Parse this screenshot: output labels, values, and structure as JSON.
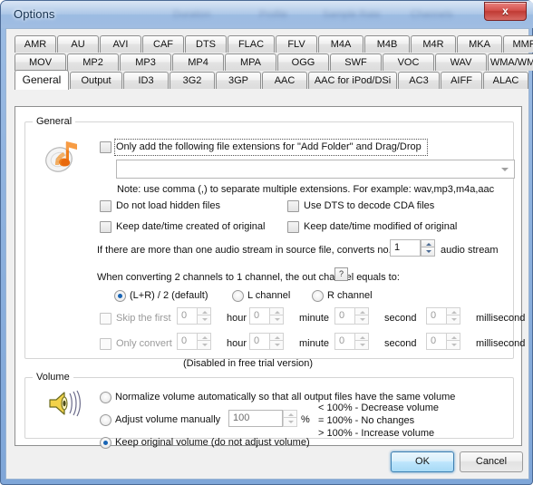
{
  "window": {
    "title": "Options",
    "close_label": "x"
  },
  "tabs": {
    "row1": [
      "AMR",
      "AU",
      "AVI",
      "CAF",
      "DTS",
      "FLAC",
      "FLV",
      "M4A",
      "M4B",
      "M4R",
      "MKA",
      "MMF"
    ],
    "row2": [
      "MOV",
      "MP2",
      "MP3",
      "MP4",
      "MPA",
      "OGG",
      "SWF",
      "VOC",
      "WAV",
      "WMA/WMV/ASF"
    ],
    "row3": [
      "General",
      "Output",
      "ID3",
      "3G2",
      "3GP",
      "AAC",
      "AAC for iPod/DSi",
      "AC3",
      "AIFF",
      "ALAC"
    ],
    "selected": "General"
  },
  "general": {
    "group_title": "General",
    "icon": "cd-music-note-icon",
    "only_add_label": "Only add the following file extensions for \"Add Folder\" and Drag/Drop",
    "only_add_checked": false,
    "extensions_value": "",
    "extensions_placeholder": "",
    "note": "Note: use comma (,) to separate multiple extensions. For example: wav,mp3,m4a,aac",
    "do_not_load_hidden_label": "Do not load hidden files",
    "do_not_load_hidden_checked": false,
    "use_dts_label": "Use DTS to decode CDA files",
    "use_dts_checked": false,
    "keep_created_label": "Keep date/time created of original",
    "keep_created_checked": false,
    "keep_modified_label": "Keep date/time modified of original",
    "keep_modified_checked": false,
    "stream_prefix": "If there are more than one audio stream in source file, converts no.",
    "stream_value": "1",
    "stream_suffix": "audio stream",
    "channel_question": "When converting 2 channels to 1 channel, the out channel equals to:",
    "help_label": "?",
    "channel_options": [
      {
        "label": "(L+R) / 2 (default)",
        "checked": true
      },
      {
        "label": "L channel",
        "checked": false
      },
      {
        "label": "R channel",
        "checked": false
      }
    ],
    "skip_label": "Skip the first",
    "skip_checked": false,
    "skip_values": [
      "0",
      "0",
      "0",
      "0"
    ],
    "only_convert_label": "Only convert",
    "only_convert_checked": false,
    "only_convert_values": [
      "0",
      "0",
      "0",
      "0"
    ],
    "time_units": [
      "hour",
      "minute",
      "second",
      "millisecond"
    ],
    "disabled_note": "(Disabled in free trial version)"
  },
  "volume": {
    "group_title": "Volume",
    "icon": "speaker-icon",
    "options": [
      {
        "label": "Normalize volume automatically so that all output files have the same volume",
        "checked": false
      },
      {
        "label": "Adjust volume manually",
        "checked": false
      },
      {
        "label": "Keep original volume (do not adjust volume)",
        "checked": true
      }
    ],
    "manual_value": "100",
    "percent_sign": "%",
    "legend": [
      "< 100% - Decrease volume",
      "= 100% - No changes",
      "> 100% - Increase volume"
    ]
  },
  "footer": {
    "ok_label": "OK",
    "cancel_label": "Cancel"
  },
  "colors": {
    "accent": "#3c7fb1",
    "radio_dot": "#1864b4",
    "title_bar": "#8fb2de",
    "close_red": "#c03a34"
  }
}
